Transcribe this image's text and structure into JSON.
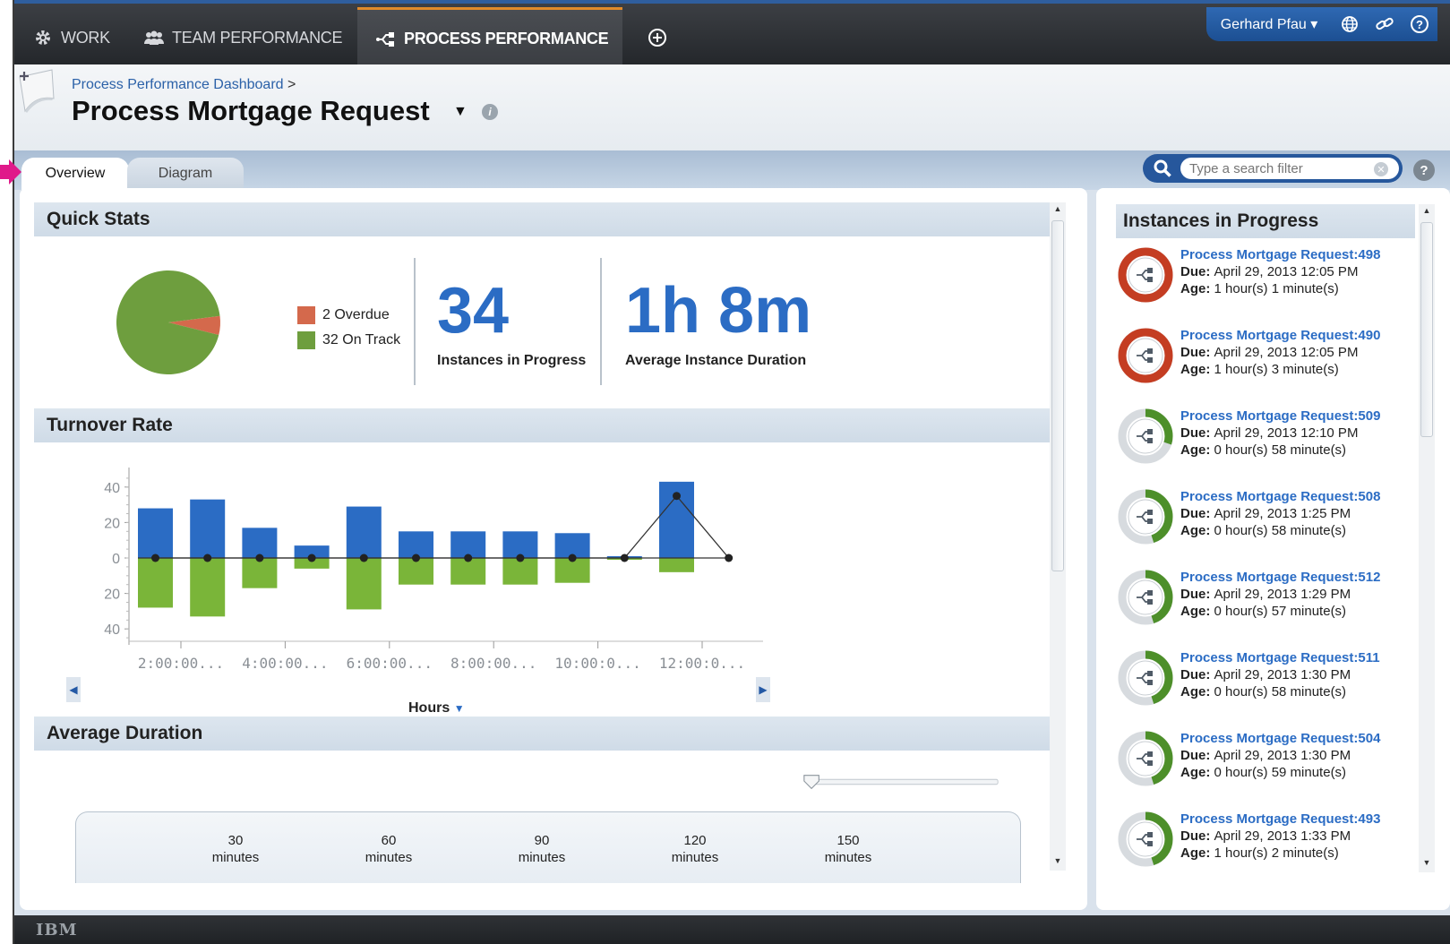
{
  "nav": {
    "tabs": [
      {
        "label": "WORK",
        "icon": "gear-icon"
      },
      {
        "label": "TEAM PERFORMANCE",
        "icon": "team-icon"
      },
      {
        "label": "PROCESS PERFORMANCE",
        "icon": "process-icon"
      }
    ],
    "add_icon": "plus-circle-icon",
    "user": "Gerhard Pfau ▾",
    "icons": [
      "globe-icon",
      "link-icon",
      "help-icon"
    ]
  },
  "header": {
    "breadcrumb": "Process Performance Dashboard",
    "breadcrumb_sep": ">",
    "title": "Process Mortgage Request"
  },
  "tabs": {
    "overview": "Overview",
    "diagram": "Diagram"
  },
  "search": {
    "placeholder": "Type a search filter"
  },
  "quick_stats": {
    "title": "Quick Stats",
    "legend": [
      {
        "count": "2",
        "label": "Overdue",
        "color": "#d4694c"
      },
      {
        "count": "32",
        "label": "On Track",
        "color": "#6e9e3e"
      }
    ],
    "instances": "34",
    "instances_caption": "Instances in Progress",
    "duration": "1h 8m",
    "duration_caption": "Average Instance Duration"
  },
  "turnover": {
    "title": "Turnover Rate",
    "hours_label": "Hours"
  },
  "average_duration": {
    "title": "Average Duration",
    "ticks": [
      {
        "v": "30",
        "u": "minutes"
      },
      {
        "v": "60",
        "u": "minutes"
      },
      {
        "v": "90",
        "u": "minutes"
      },
      {
        "v": "120",
        "u": "minutes"
      },
      {
        "v": "150",
        "u": "minutes"
      }
    ]
  },
  "instances_panel": {
    "title": "Instances in Progress",
    "due_label": "Due:",
    "age_label": "Age:",
    "items": [
      {
        "name": "Process Mortgage Request:498",
        "due": "April 29, 2013 12:05 PM",
        "age": "1 hour(s) 1 minute(s)",
        "overdue": true
      },
      {
        "name": "Process Mortgage Request:490",
        "due": "April 29, 2013 12:05 PM",
        "age": "1 hour(s) 3 minute(s)",
        "overdue": true
      },
      {
        "name": "Process Mortgage Request:509",
        "due": "April 29, 2013 12:10 PM",
        "age": "0 hour(s) 58 minute(s)",
        "overdue": false,
        "progress": 0.3
      },
      {
        "name": "Process Mortgage Request:508",
        "due": "April 29, 2013 1:25 PM",
        "age": "0 hour(s) 58 minute(s)",
        "overdue": false,
        "progress": 0.45
      },
      {
        "name": "Process Mortgage Request:512",
        "due": "April 29, 2013 1:29 PM",
        "age": "0 hour(s) 57 minute(s)",
        "overdue": false,
        "progress": 0.45
      },
      {
        "name": "Process Mortgage Request:511",
        "due": "April 29, 2013 1:30 PM",
        "age": "0 hour(s) 58 minute(s)",
        "overdue": false,
        "progress": 0.45
      },
      {
        "name": "Process Mortgage Request:504",
        "due": "April 29, 2013 1:30 PM",
        "age": "0 hour(s) 59 minute(s)",
        "overdue": false,
        "progress": 0.45
      },
      {
        "name": "Process Mortgage Request:493",
        "due": "April 29, 2013 1:33 PM",
        "age": "1 hour(s) 2 minute(s)",
        "overdue": false,
        "progress": 0.45
      }
    ]
  },
  "footer": {
    "logo": "IBM"
  },
  "chart_data": [
    {
      "type": "pie",
      "categories": [
        "Overdue",
        "On Track"
      ],
      "values": [
        2,
        32
      ],
      "colors": [
        "#d4694c",
        "#6e9e3e"
      ]
    },
    {
      "type": "bar",
      "x_ticks": [
        "2:00:00...",
        "4:00:00...",
        "6:00:00...",
        "8:00:00...",
        "10:00:0...",
        "12:00:0..."
      ],
      "y_ticks": [
        "40",
        "20",
        "0",
        "20",
        "40"
      ],
      "ylim": [
        -40,
        40
      ],
      "series": [
        {
          "values": [
            28,
            33,
            17,
            7,
            29,
            15,
            15,
            15,
            14,
            1,
            43
          ],
          "color": "#2b6cc4"
        },
        {
          "values": [
            -28,
            -33,
            -17,
            -6,
            -29,
            -15,
            -15,
            -15,
            -14,
            -1,
            -8
          ],
          "color": "#7ab539"
        },
        {
          "type": "line",
          "values": [
            0,
            0,
            0,
            0,
            0,
            0,
            0,
            0,
            0,
            0,
            35,
            0
          ],
          "color": "#333333"
        }
      ]
    }
  ]
}
